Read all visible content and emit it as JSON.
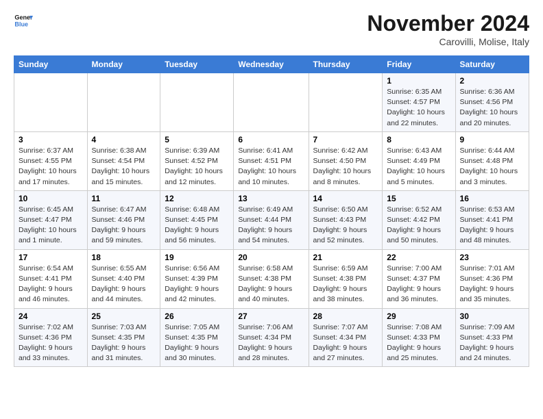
{
  "header": {
    "logo_line1": "General",
    "logo_line2": "Blue",
    "month": "November 2024",
    "location": "Carovilli, Molise, Italy"
  },
  "weekdays": [
    "Sunday",
    "Monday",
    "Tuesday",
    "Wednesday",
    "Thursday",
    "Friday",
    "Saturday"
  ],
  "weeks": [
    [
      {
        "day": "",
        "info": ""
      },
      {
        "day": "",
        "info": ""
      },
      {
        "day": "",
        "info": ""
      },
      {
        "day": "",
        "info": ""
      },
      {
        "day": "",
        "info": ""
      },
      {
        "day": "1",
        "info": "Sunrise: 6:35 AM\nSunset: 4:57 PM\nDaylight: 10 hours and 22 minutes."
      },
      {
        "day": "2",
        "info": "Sunrise: 6:36 AM\nSunset: 4:56 PM\nDaylight: 10 hours and 20 minutes."
      }
    ],
    [
      {
        "day": "3",
        "info": "Sunrise: 6:37 AM\nSunset: 4:55 PM\nDaylight: 10 hours and 17 minutes."
      },
      {
        "day": "4",
        "info": "Sunrise: 6:38 AM\nSunset: 4:54 PM\nDaylight: 10 hours and 15 minutes."
      },
      {
        "day": "5",
        "info": "Sunrise: 6:39 AM\nSunset: 4:52 PM\nDaylight: 10 hours and 12 minutes."
      },
      {
        "day": "6",
        "info": "Sunrise: 6:41 AM\nSunset: 4:51 PM\nDaylight: 10 hours and 10 minutes."
      },
      {
        "day": "7",
        "info": "Sunrise: 6:42 AM\nSunset: 4:50 PM\nDaylight: 10 hours and 8 minutes."
      },
      {
        "day": "8",
        "info": "Sunrise: 6:43 AM\nSunset: 4:49 PM\nDaylight: 10 hours and 5 minutes."
      },
      {
        "day": "9",
        "info": "Sunrise: 6:44 AM\nSunset: 4:48 PM\nDaylight: 10 hours and 3 minutes."
      }
    ],
    [
      {
        "day": "10",
        "info": "Sunrise: 6:45 AM\nSunset: 4:47 PM\nDaylight: 10 hours and 1 minute."
      },
      {
        "day": "11",
        "info": "Sunrise: 6:47 AM\nSunset: 4:46 PM\nDaylight: 9 hours and 59 minutes."
      },
      {
        "day": "12",
        "info": "Sunrise: 6:48 AM\nSunset: 4:45 PM\nDaylight: 9 hours and 56 minutes."
      },
      {
        "day": "13",
        "info": "Sunrise: 6:49 AM\nSunset: 4:44 PM\nDaylight: 9 hours and 54 minutes."
      },
      {
        "day": "14",
        "info": "Sunrise: 6:50 AM\nSunset: 4:43 PM\nDaylight: 9 hours and 52 minutes."
      },
      {
        "day": "15",
        "info": "Sunrise: 6:52 AM\nSunset: 4:42 PM\nDaylight: 9 hours and 50 minutes."
      },
      {
        "day": "16",
        "info": "Sunrise: 6:53 AM\nSunset: 4:41 PM\nDaylight: 9 hours and 48 minutes."
      }
    ],
    [
      {
        "day": "17",
        "info": "Sunrise: 6:54 AM\nSunset: 4:41 PM\nDaylight: 9 hours and 46 minutes."
      },
      {
        "day": "18",
        "info": "Sunrise: 6:55 AM\nSunset: 4:40 PM\nDaylight: 9 hours and 44 minutes."
      },
      {
        "day": "19",
        "info": "Sunrise: 6:56 AM\nSunset: 4:39 PM\nDaylight: 9 hours and 42 minutes."
      },
      {
        "day": "20",
        "info": "Sunrise: 6:58 AM\nSunset: 4:38 PM\nDaylight: 9 hours and 40 minutes."
      },
      {
        "day": "21",
        "info": "Sunrise: 6:59 AM\nSunset: 4:38 PM\nDaylight: 9 hours and 38 minutes."
      },
      {
        "day": "22",
        "info": "Sunrise: 7:00 AM\nSunset: 4:37 PM\nDaylight: 9 hours and 36 minutes."
      },
      {
        "day": "23",
        "info": "Sunrise: 7:01 AM\nSunset: 4:36 PM\nDaylight: 9 hours and 35 minutes."
      }
    ],
    [
      {
        "day": "24",
        "info": "Sunrise: 7:02 AM\nSunset: 4:36 PM\nDaylight: 9 hours and 33 minutes."
      },
      {
        "day": "25",
        "info": "Sunrise: 7:03 AM\nSunset: 4:35 PM\nDaylight: 9 hours and 31 minutes."
      },
      {
        "day": "26",
        "info": "Sunrise: 7:05 AM\nSunset: 4:35 PM\nDaylight: 9 hours and 30 minutes."
      },
      {
        "day": "27",
        "info": "Sunrise: 7:06 AM\nSunset: 4:34 PM\nDaylight: 9 hours and 28 minutes."
      },
      {
        "day": "28",
        "info": "Sunrise: 7:07 AM\nSunset: 4:34 PM\nDaylight: 9 hours and 27 minutes."
      },
      {
        "day": "29",
        "info": "Sunrise: 7:08 AM\nSunset: 4:33 PM\nDaylight: 9 hours and 25 minutes."
      },
      {
        "day": "30",
        "info": "Sunrise: 7:09 AM\nSunset: 4:33 PM\nDaylight: 9 hours and 24 minutes."
      }
    ]
  ]
}
